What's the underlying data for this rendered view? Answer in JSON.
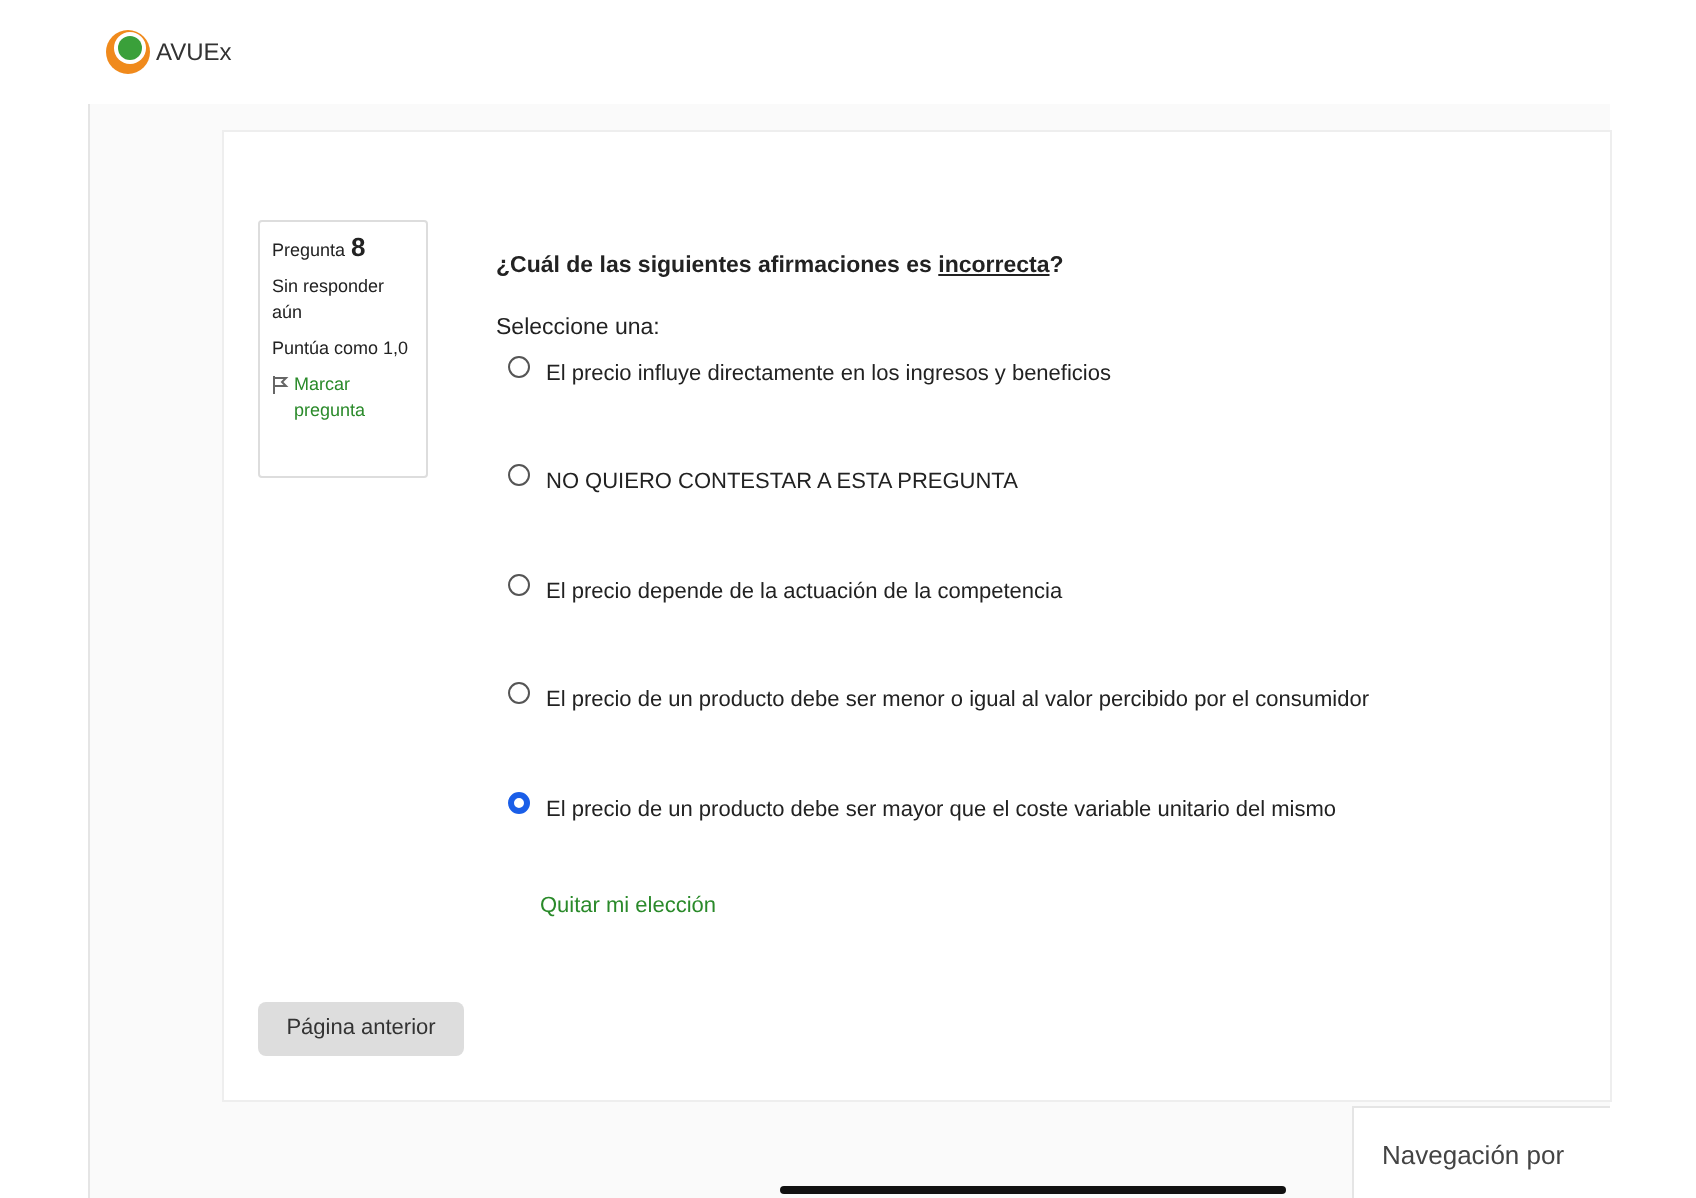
{
  "header": {
    "logo_text": "AVUEx"
  },
  "question_info": {
    "label": "Pregunta",
    "number": "8",
    "status": "Sin responder aún",
    "grade": "Puntúa como 1,0",
    "flag_link": "Marcar pregunta"
  },
  "question": {
    "text_before": "¿Cuál de las siguientes afirmaciones es ",
    "text_underlined": "incorrecta",
    "text_after": "?",
    "prompt": "Seleccione una:"
  },
  "options": [
    {
      "label": "El precio influye directamente en los ingresos y beneficios",
      "selected": false
    },
    {
      "label": "NO QUIERO CONTESTAR A ESTA PREGUNTA",
      "selected": false
    },
    {
      "label": "El precio depende de la actuación de la competencia",
      "selected": false
    },
    {
      "label": "El precio de un producto debe ser menor o igual al valor percibido por el consumidor",
      "selected": false
    },
    {
      "label": "El precio de un producto debe ser mayor que el coste variable unitario del mismo",
      "selected": true
    }
  ],
  "clear_choice_link": "Quitar mi elección",
  "previous_page_button": "Página anterior",
  "navigation_panel": {
    "title": "Navegación por"
  }
}
